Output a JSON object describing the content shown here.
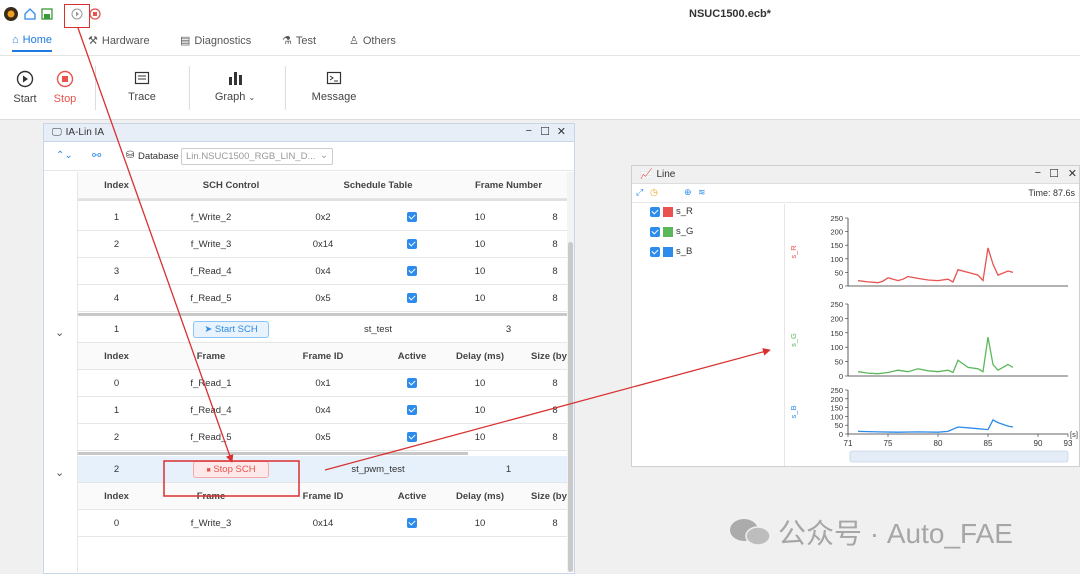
{
  "app": {
    "title": "NSUC1500.ecb*"
  },
  "tabs": [
    {
      "label": "Home"
    },
    {
      "label": "Hardware"
    },
    {
      "label": "Diagnostics"
    },
    {
      "label": "Test"
    },
    {
      "label": "Others"
    }
  ],
  "ribbon": {
    "start": "Start",
    "stop": "Stop",
    "trace": "Trace",
    "graph": "Graph",
    "message": "Message"
  },
  "lin_window": {
    "title": "IA-Lin IA",
    "database_label": "Database",
    "database_value": "Lin.NSUC1500_RGB_LIN_D...",
    "top_headers": [
      "Index",
      "SCH Control",
      "Schedule Table",
      "Frame Number"
    ],
    "top_rows": [
      {
        "index": "1",
        "frame": "f_Write_2",
        "id": "0x2",
        "delay": "10",
        "size": "8"
      },
      {
        "index": "2",
        "frame": "f_Write_3",
        "id": "0x14",
        "delay": "10",
        "size": "8"
      },
      {
        "index": "3",
        "frame": "f_Read_4",
        "id": "0x4",
        "delay": "10",
        "size": "8"
      },
      {
        "index": "4",
        "frame": "f_Read_5",
        "id": "0x5",
        "delay": "10",
        "size": "8"
      }
    ],
    "sch1": {
      "index": "1",
      "button": "Start SCH",
      "table": "st_test",
      "frames": "3"
    },
    "frame_headers": [
      "Index",
      "Frame",
      "Frame ID",
      "Active",
      "Delay (ms)",
      "Size (by"
    ],
    "sch1_rows": [
      {
        "index": "0",
        "frame": "f_Read_1",
        "id": "0x1",
        "delay": "10",
        "size": "8"
      },
      {
        "index": "1",
        "frame": "f_Read_4",
        "id": "0x4",
        "delay": "10",
        "size": "8"
      },
      {
        "index": "2",
        "frame": "f_Read_5",
        "id": "0x5",
        "delay": "10",
        "size": "8"
      }
    ],
    "sch2": {
      "index": "2",
      "button": "Stop SCH",
      "table": "st_pwm_test",
      "frames": "1"
    },
    "sch2_rows": [
      {
        "index": "0",
        "frame": "f_Write_3",
        "id": "0x14",
        "delay": "10",
        "size": "8"
      }
    ]
  },
  "line_window": {
    "title": "Line",
    "time": "Time: 87.6s",
    "signals": [
      {
        "name": "s_R",
        "color": "#e8524f"
      },
      {
        "name": "s_G",
        "color": "#5cb85c"
      },
      {
        "name": "s_B",
        "color": "#2d8ceb"
      }
    ]
  },
  "chart_data": {
    "type": "line",
    "x_ticks": [
      "71",
      "75",
      "80",
      "85",
      "90",
      "93"
    ],
    "xlim": [
      71,
      93
    ],
    "xlabel": "[s]",
    "panels": [
      {
        "ylabel": "s_R",
        "yticks": [
          "250",
          "200",
          "150",
          "100",
          "50",
          "0"
        ],
        "ylim": [
          0,
          250
        ],
        "color": "#e8524f",
        "x": [
          72,
          73,
          74,
          74.5,
          75,
          76,
          76.5,
          77,
          78,
          79,
          80,
          81,
          81.5,
          82,
          83,
          84,
          84.5,
          85,
          85.5,
          86,
          87,
          87.5
        ],
        "y": [
          20,
          15,
          12,
          18,
          30,
          20,
          25,
          35,
          28,
          22,
          20,
          25,
          15,
          60,
          50,
          40,
          20,
          140,
          80,
          40,
          55,
          50
        ]
      },
      {
        "ylabel": "s_G",
        "yticks": [
          "250",
          "200",
          "150",
          "100",
          "50",
          "0"
        ],
        "ylim": [
          0,
          250
        ],
        "color": "#5cb85c",
        "x": [
          72,
          73,
          74,
          75,
          76,
          77,
          78,
          79,
          80,
          81,
          81.5,
          82,
          83,
          84,
          84.5,
          85,
          85.5,
          86,
          87,
          87.5
        ],
        "y": [
          15,
          10,
          8,
          12,
          20,
          15,
          25,
          18,
          15,
          20,
          12,
          55,
          30,
          25,
          15,
          135,
          40,
          20,
          40,
          30
        ]
      },
      {
        "ylabel": "s_B",
        "yticks": [
          "250",
          "200",
          "150",
          "100",
          "50",
          "0"
        ],
        "ylim": [
          0,
          250
        ],
        "color": "#2d8ceb",
        "x": [
          72,
          74,
          76,
          78,
          80,
          81,
          82,
          83,
          84,
          85,
          85.5,
          86,
          87,
          87.5
        ],
        "y": [
          15,
          12,
          10,
          12,
          10,
          15,
          40,
          35,
          30,
          25,
          80,
          65,
          45,
          40
        ]
      }
    ]
  },
  "watermark": "公众号 · Auto_FAE"
}
